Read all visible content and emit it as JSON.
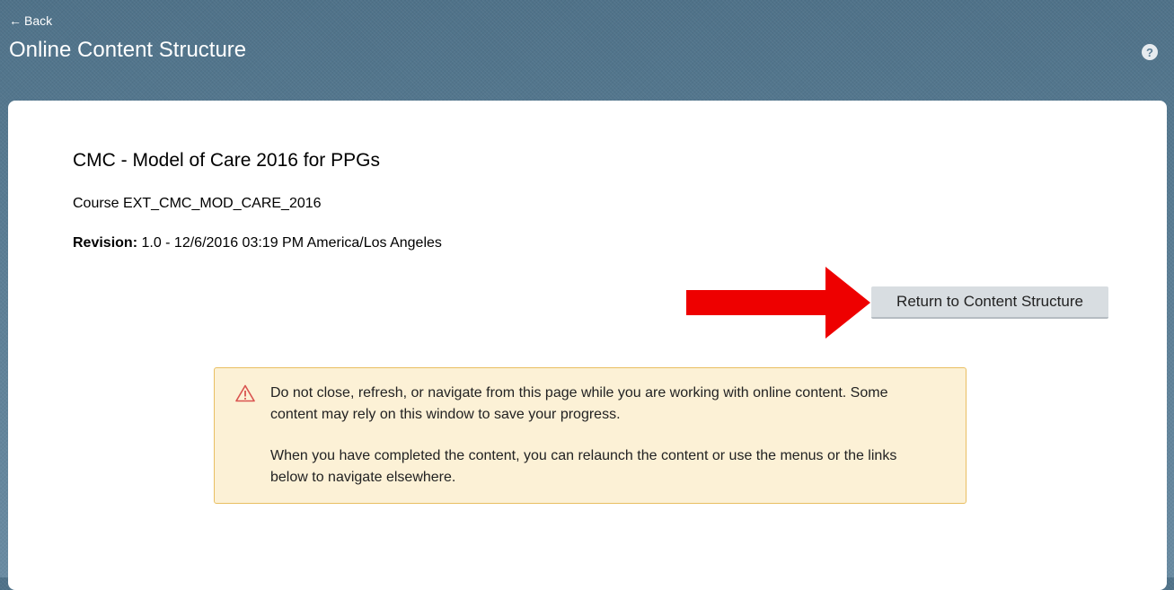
{
  "header": {
    "back_arrow": "←",
    "back_label": "Back",
    "title": "Online Content Structure",
    "help_glyph": "?",
    "help_icon": "help-icon"
  },
  "course": {
    "title": "CMC - Model of Care 2016 for PPGs",
    "code_line": "Course EXT_CMC_MOD_CARE_2016",
    "revision_label": "Revision:",
    "revision_value": "1.0 - 12/6/2016 03:19 PM America/Los Angeles"
  },
  "actions": {
    "return_label": "Return to Content Structure"
  },
  "warning": {
    "icon": "warning-triangle-icon",
    "paragraph1": "Do not close, refresh, or navigate from this page while you are working with online content. Some content may rely on this window to save your progress.",
    "paragraph2": "When you have completed the content, you can relaunch the content or use the menus or the links below to navigate elsewhere."
  },
  "colors": {
    "header_bg": "#5c7e95",
    "arrow_annotation": "#ee0000",
    "warning_bg": "#fcf1d6",
    "warning_border": "#e9bf62",
    "button_bg": "#d8dde1"
  }
}
